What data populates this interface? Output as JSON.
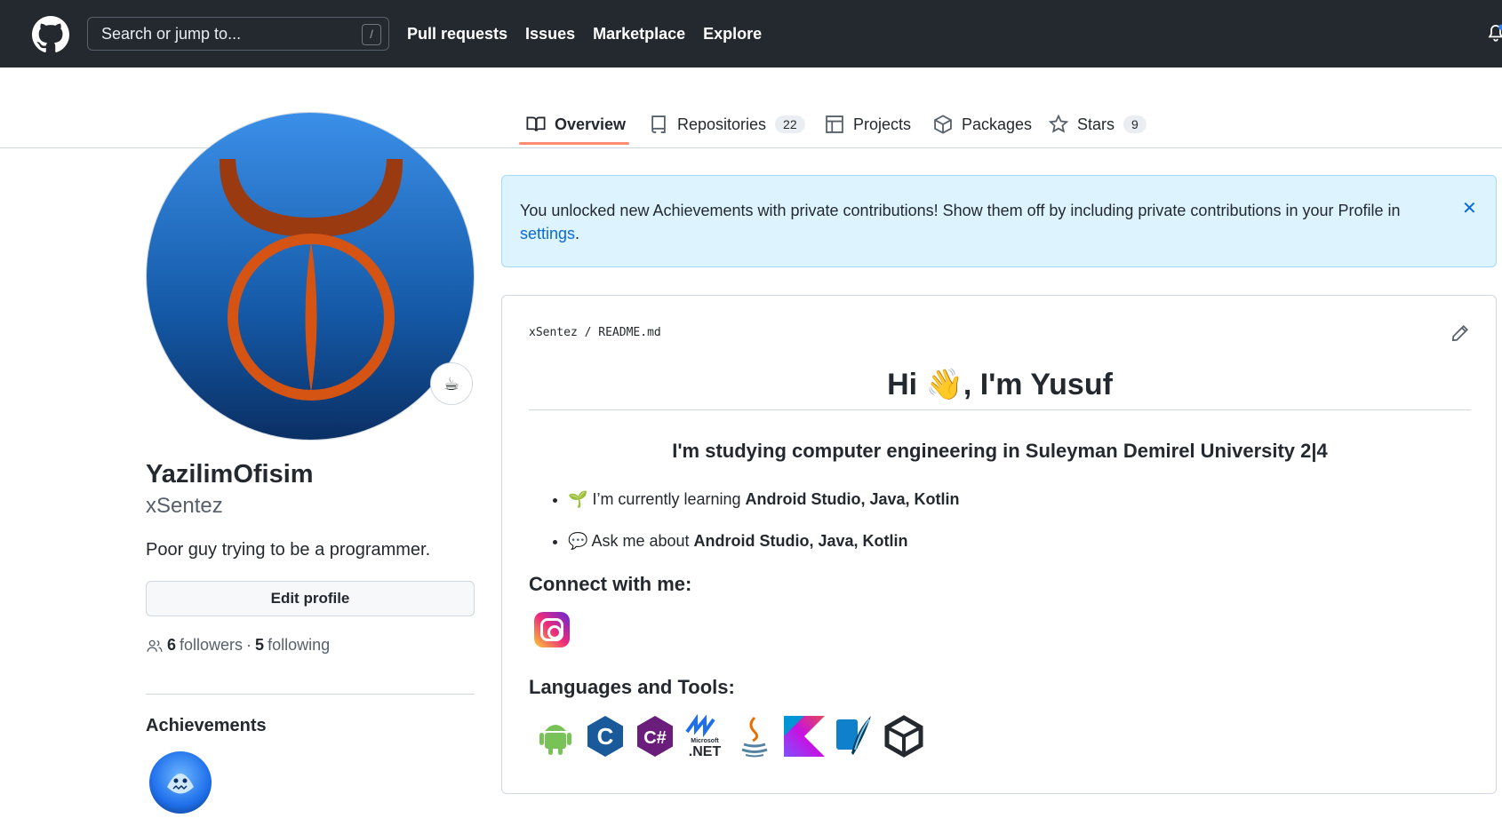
{
  "header": {
    "search_placeholder": "Search or jump to...",
    "slash_key": "/",
    "nav": [
      "Pull requests",
      "Issues",
      "Marketplace",
      "Explore"
    ]
  },
  "tabs": [
    {
      "label": "Overview",
      "icon": "book-icon",
      "active": true
    },
    {
      "label": "Repositories",
      "icon": "repo-icon",
      "count": "22"
    },
    {
      "label": "Projects",
      "icon": "table-icon"
    },
    {
      "label": "Packages",
      "icon": "package-icon"
    },
    {
      "label": "Stars",
      "icon": "star-icon",
      "count": "9"
    }
  ],
  "profile": {
    "name": "YazilimOfisim",
    "login": "xSentez",
    "bio": "Poor guy trying to be a programmer.",
    "edit_label": "Edit profile",
    "followers_count": "6",
    "followers_label": "followers",
    "separator": "·",
    "following_count": "5",
    "following_label": "following",
    "achievements_title": "Achievements",
    "status_emoji": "☕"
  },
  "flash": {
    "text": "You unlocked new Achievements with private contributions! Show them off by including private contributions in your Profile in ",
    "link": "settings",
    "period": ".",
    "close": "✕"
  },
  "readme": {
    "owner": "xSentez",
    "sep": "/",
    "file": "README.md",
    "title_before": "Hi ",
    "title_emoji": "👋",
    "title_after": ", I'm Yusuf",
    "subtitle": "I'm studying computer engineering in Suleyman Demirel University 2|4",
    "bullets": [
      {
        "emoji": "🌱",
        "text": "I’m currently learning ",
        "bold": "Android Studio, Java, Kotlin"
      },
      {
        "emoji": "💬",
        "text": "Ask me about ",
        "bold": "Android Studio, Java, Kotlin"
      }
    ],
    "connect_title": "Connect with me:",
    "tools_title": "Languages and Tools:",
    "tools": [
      "android-icon",
      "c-icon",
      "csharp-icon",
      "dotnet-icon",
      "java-icon",
      "kotlin-icon",
      "sqlite-icon",
      "unity-icon"
    ],
    "dotnet_small": "Microsoft",
    "dotnet_big": ".NET",
    "c_label": "C",
    "csharp_label": "C#"
  },
  "colors": {
    "header_bg": "#24292f",
    "accent_underline": "#fd8c73",
    "link": "#0969da",
    "flash_bg": "#ddf4ff"
  }
}
